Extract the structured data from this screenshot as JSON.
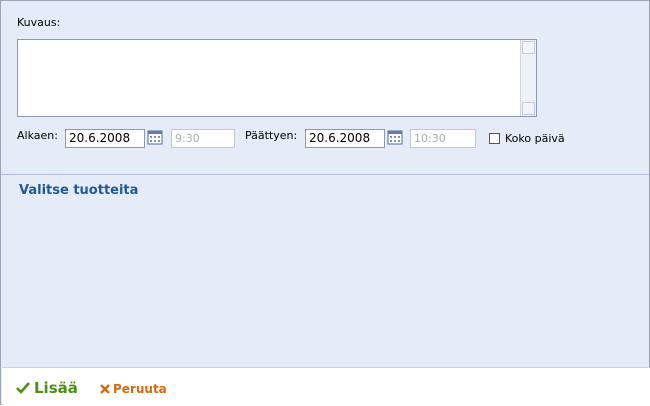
{
  "form": {
    "description_label": "Kuvaus:",
    "description_value": "",
    "start_label": "Alkaen:",
    "start_date": "20.6.2008",
    "start_time": "9:30",
    "end_label": "Päättyen:",
    "end_date": "20.6.2008",
    "end_time": "10:30",
    "all_day_label": "Koko päivä"
  },
  "products": {
    "title": "Valitse tuotteita"
  },
  "footer": {
    "add_label": "Lisää",
    "cancel_label": "Peruuta"
  },
  "colors": {
    "background": "#e6ecf7",
    "title": "#1f5a96",
    "add": "#4e8f16",
    "cancel": "#d6690f"
  }
}
